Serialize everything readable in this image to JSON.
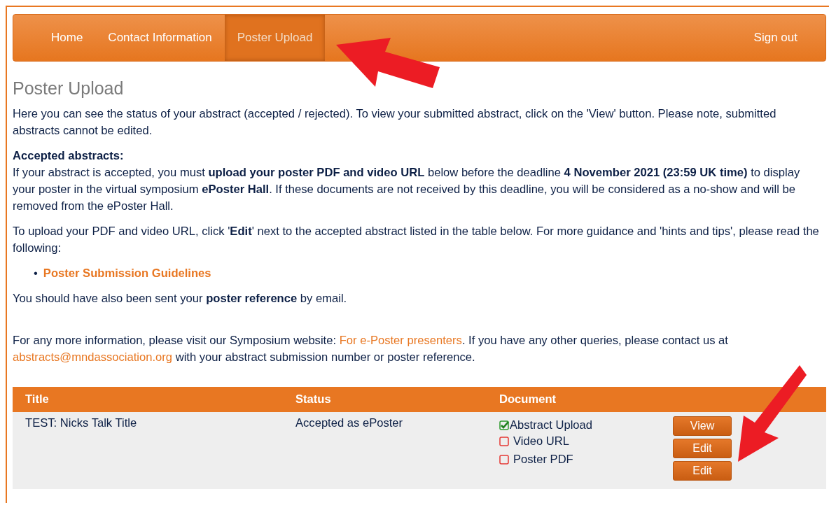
{
  "nav": {
    "items": [
      {
        "label": "Home",
        "selected": false
      },
      {
        "label": "Contact Information",
        "selected": false
      },
      {
        "label": "Poster Upload",
        "selected": true
      }
    ],
    "sign_out": "Sign out"
  },
  "heading": "Poster Upload",
  "paragraphs": [
    [
      {
        "kind": "text",
        "text": "Here you can see the status of your abstract (accepted / rejected). To view your submitted abstract, click on the 'View' button. Please note, submitted abstracts cannot be edited."
      }
    ],
    [
      {
        "kind": "heading",
        "text": "Accepted abstracts:"
      },
      {
        "kind": "text",
        "text": "If your abstract is accepted, you must **upload your poster PDF and video URL** below before the deadline **4 November 2021 (23:59 UK time)** to display your poster in the virtual symposium **ePoster Hall**. If these documents are not received by this deadline, you will be considered as a no-show and will be removed from the ePoster Hall."
      }
    ],
    [
      {
        "kind": "text",
        "text": "To upload your PDF and video URL, click '**Edit**' next to the accepted abstract listed in the table below. For more guidance and 'hints and tips', please read the following:"
      }
    ]
  ],
  "guidelines": [
    {
      "marker": "•",
      "text": "Poster Submission Guidelines"
    }
  ],
  "email_note": "You should have also been sent your **poster reference** by email.",
  "info": [
    {
      "kind": "text",
      "text": "For any more information, please visit our Symposium website: "
    },
    {
      "kind": "link",
      "text": "For e-Poster presenters"
    },
    {
      "kind": "text",
      "text": ". If you have any other queries, please contact us at "
    },
    {
      "kind": "link",
      "text": "abstracts@mndassociation.org"
    },
    {
      "kind": "text",
      "text": " with your abstract submission number or poster reference."
    }
  ],
  "table": {
    "columns": [
      "Title",
      "Status",
      "Document"
    ],
    "rows": [
      {
        "title": "TEST: Nicks Talk Title",
        "status": "Accepted as ePoster",
        "documents": [
          {
            "name": "Abstract Upload",
            "checked": true,
            "button": "View"
          },
          {
            "name": "Video URL",
            "checked": false,
            "button": "Edit"
          },
          {
            "name": "Poster PDF",
            "checked": false,
            "button": "Edit"
          }
        ]
      }
    ]
  }
}
